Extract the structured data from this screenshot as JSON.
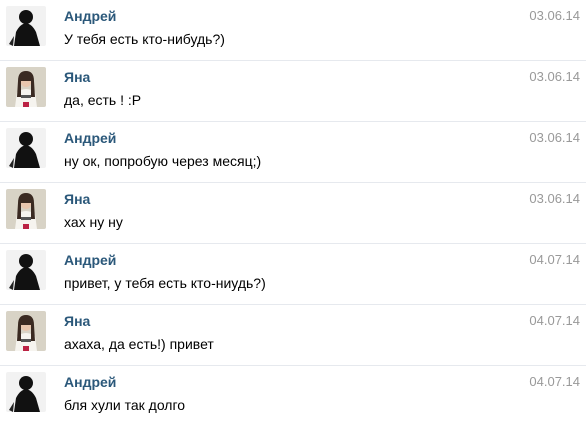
{
  "messages": [
    {
      "author": "Андрей",
      "date": "03.06.14",
      "text": "У тебя есть кто-нибудь?)",
      "avatar": "andrey"
    },
    {
      "author": "Яна",
      "date": "03.06.14",
      "text": "да, есть ! :P",
      "avatar": "yana"
    },
    {
      "author": "Андрей",
      "date": "03.06.14",
      "text": "ну ок, попробую через месяц;)",
      "avatar": "andrey"
    },
    {
      "author": "Яна",
      "date": "03.06.14",
      "text": "хах ну ну",
      "avatar": "yana"
    },
    {
      "author": "Андрей",
      "date": "04.07.14",
      "text": "привет, у тебя есть кто-ниудь?)",
      "avatar": "andrey"
    },
    {
      "author": "Яна",
      "date": "04.07.14",
      "text": "ахаха, да есть!) привет",
      "avatar": "yana"
    },
    {
      "author": "Андрей",
      "date": "04.07.14",
      "text": "бля хули так долго",
      "avatar": "andrey"
    }
  ],
  "colors": {
    "author_link": "#2b587a",
    "date": "#999999",
    "divider": "#e6e9ee"
  }
}
